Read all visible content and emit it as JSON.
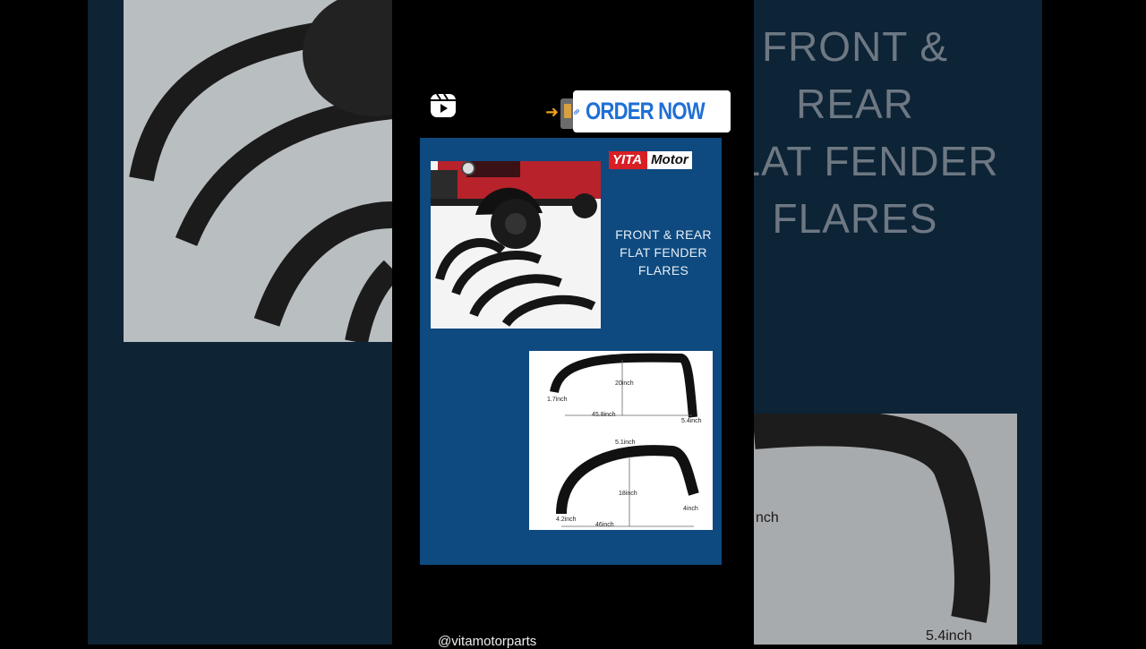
{
  "post": {
    "order_button": "ORDER NOW",
    "handle": "@vitamotorparts"
  },
  "card": {
    "brand_part1": "YITA",
    "brand_part2": "Motor",
    "headline_lines": [
      "FRONT & REAR",
      "FLAT FENDER",
      "FLARES"
    ]
  },
  "dimensions": {
    "top_flare": {
      "height": "20inch",
      "width": "45.8inch",
      "left_edge": "1.7inch",
      "right_edge": "5.4inch"
    },
    "bottom_flare": {
      "top": "5.1inch",
      "height": "18inch",
      "width": "46inch",
      "left_edge": "4.2inch",
      "right_edge": "4inch"
    }
  },
  "background": {
    "headline": "FRONT & REAR\nFLAT FENDER\nFLARES",
    "dim_partial": "nch",
    "dim_bottom": "5.4inch"
  },
  "colors": {
    "card_blue": "#0e4a7f",
    "order_text": "#1f6fd6",
    "brand_red": "#d81f26"
  },
  "icons": [
    "reels-icon",
    "arrow-right-icon",
    "phone-icon",
    "link-icon"
  ]
}
